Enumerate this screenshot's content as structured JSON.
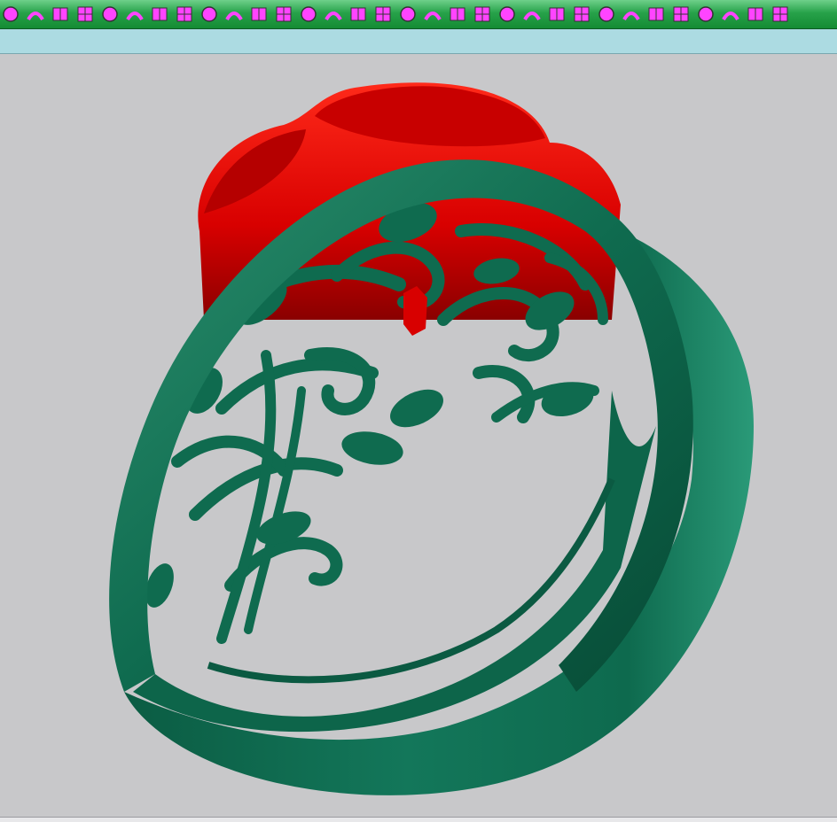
{
  "toolbar": {
    "buttons": [
      {
        "icon": "circle-tool-icon",
        "fill": "#ff44ff"
      },
      {
        "icon": "arc-tool-icon",
        "fill": "#ff44ff"
      },
      {
        "icon": "book-open-icon",
        "fill": "#ff44ff"
      },
      {
        "icon": "table-icon",
        "fill": "#ff44ff"
      },
      {
        "icon": "cube-icon",
        "fill": "#ff44ff"
      },
      {
        "icon": "tube-icon",
        "fill": "#ff44ff"
      },
      {
        "icon": "hierarchy-icon",
        "fill": "#ff44ff"
      },
      {
        "icon": "frame-icon",
        "fill": "#ff44ff"
      },
      {
        "icon": "grid-icon",
        "fill": "#ff44ff"
      },
      {
        "icon": "stack-icon",
        "fill": "#ff44ff"
      },
      {
        "icon": "grid-cross-icon",
        "fill": "#ff44ff"
      },
      {
        "icon": "pen-curve-icon",
        "fill": "#ff44ff"
      },
      {
        "icon": "pen-rail-icon",
        "fill": "#ff44ff"
      },
      {
        "icon": "ring-shank-icon",
        "fill": "#ff44ff"
      },
      {
        "icon": "ribbon-icon",
        "fill": "#ff44ff"
      },
      {
        "icon": "band-icon",
        "fill": "#ff44ff"
      },
      {
        "icon": "dot-grid-icon",
        "fill": "#ff44ff"
      },
      {
        "icon": "bend-icon",
        "fill": "#ff44ff"
      },
      {
        "icon": "hand-icon",
        "fill": "#ff44ff"
      },
      {
        "icon": "scatter-icon",
        "fill": "#ff44ff"
      },
      {
        "icon": "prong-icon",
        "fill": "#ff44ff"
      },
      {
        "icon": "diamond-icon",
        "fill": "#ff44ff"
      },
      {
        "icon": "pivot-icon",
        "fill": "#ff44ff"
      },
      {
        "icon": "star-curve-icon",
        "fill": "#ff44ff"
      },
      {
        "icon": "pentagon-icon",
        "fill": "#ff44ff"
      },
      {
        "icon": "comb-icon",
        "fill": "#ff44ff"
      },
      {
        "icon": "surface-icon",
        "fill": "#ff44ff"
      },
      {
        "icon": "patch-icon",
        "fill": "#ff44ff"
      },
      {
        "icon": "mesh-icon",
        "fill": "#ff44ff"
      },
      {
        "icon": "cross-icon",
        "fill": "#ff44ff"
      },
      {
        "icon": "gem-icon",
        "fill": "#ff44ff"
      },
      {
        "icon": "gear-icon",
        "fill": "#ff44ff"
      }
    ]
  },
  "viewport": {
    "background": "#c8c8ca",
    "model": {
      "band_color": "#0f6b4f",
      "band_highlight": "#2c8f6e",
      "flower_color": "#e00000",
      "flower_shadow": "#8a0000"
    }
  }
}
